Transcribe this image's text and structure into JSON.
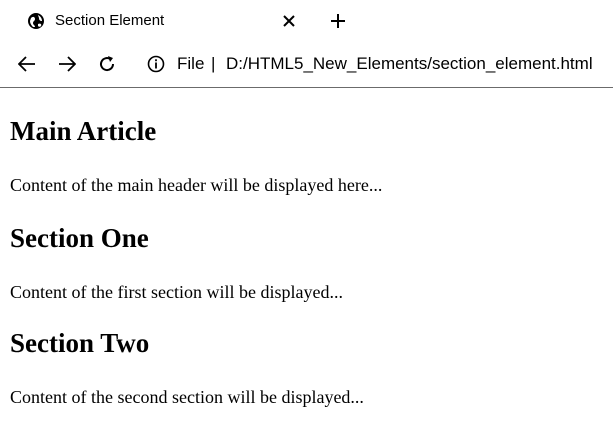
{
  "tab": {
    "title": "Section Element",
    "favicon": "globe-icon",
    "close_icon": "close-icon",
    "new_tab_icon": "plus-icon"
  },
  "toolbar": {
    "back_icon": "arrow-left-icon",
    "forward_icon": "arrow-right-icon",
    "reload_icon": "reload-icon",
    "info_icon": "info-icon",
    "scheme_label": "File",
    "separator": "|",
    "url": "D:/HTML5_New_Elements/section_element.html"
  },
  "page": {
    "main_heading": "Main Article",
    "main_text": "Content of the main header will be displayed here...",
    "section_one_heading": "Section One",
    "section_one_text": "Content of the first section will be displayed...",
    "section_two_heading": "Section Two",
    "section_two_text": "Content of the second section will be displayed..."
  },
  "colors": {
    "background": "#ffffff",
    "text": "#000000",
    "toolbar_border": "#6b6b6b"
  }
}
